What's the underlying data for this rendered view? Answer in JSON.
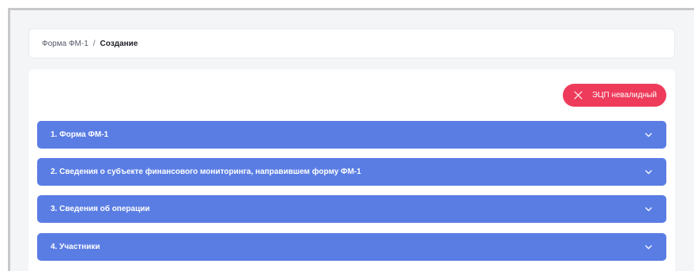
{
  "breadcrumb": {
    "parent": "Форма ФМ-1",
    "separator": "/",
    "current": "Создание"
  },
  "status_badge": {
    "label": "ЭЦП невалидный",
    "icon": "close-icon",
    "color": "#ee3b5b"
  },
  "sections": [
    {
      "label": "1. Форма ФМ-1",
      "icon": "chevron-down-icon"
    },
    {
      "label": "2. Сведения о субъекте финансового мониторинга, направившем форму ФМ-1",
      "icon": "chevron-down-icon"
    },
    {
      "label": "3. Сведения об операции",
      "icon": "chevron-down-icon"
    },
    {
      "label": "4. Участники",
      "icon": "chevron-down-icon"
    }
  ],
  "colors": {
    "section_bg": "#5a7de4",
    "badge_bg": "#ee3b5b",
    "page_bg": "#f4f5f7"
  }
}
